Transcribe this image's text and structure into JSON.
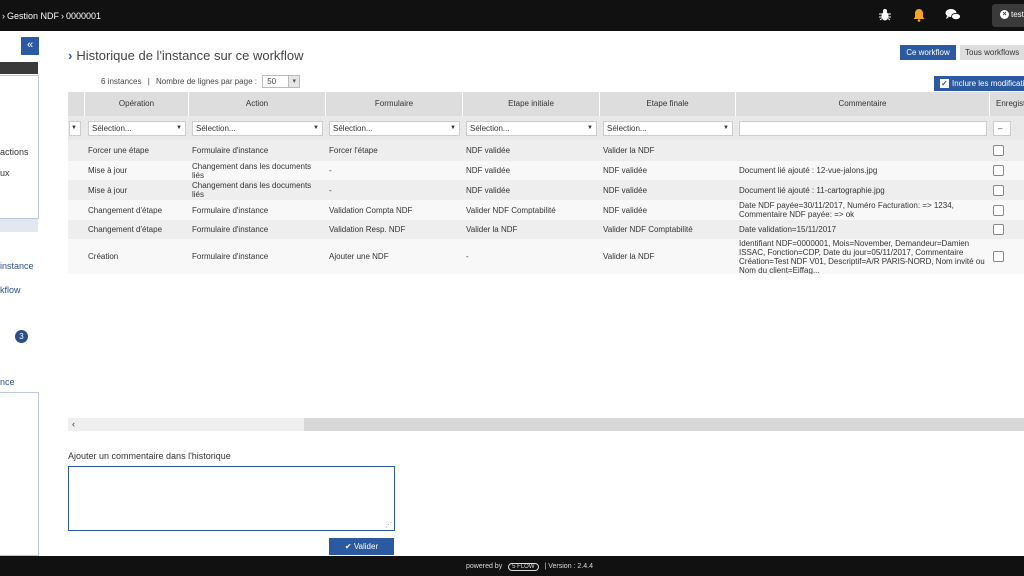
{
  "header": {
    "breadcrumb": [
      "Gestion NDF",
      "0000001"
    ],
    "icons": [
      "bug-icon",
      "bell-icon",
      "chat-icon"
    ],
    "user_label": "test"
  },
  "sidebar": {
    "items": [
      {
        "label": "actions"
      },
      {
        "label": "ux"
      },
      {
        "label": "instance"
      },
      {
        "label": "kflow"
      },
      {
        "label": "nce"
      }
    ],
    "badge": "3"
  },
  "main": {
    "title": "Historique de l'instance sur ce workflow",
    "buttons": {
      "ce_workflow": "Ce workflow",
      "tous_workflows": "Tous workflows"
    },
    "include_changes_label": "Inclure les modifications",
    "instance_count": "6 instances",
    "separator": "|",
    "rows_per_page_label": "Nombre de lignes par page :",
    "rows_per_page_value": "50"
  },
  "table": {
    "columns": [
      "Opération",
      "Action",
      "Formulaire",
      "Etape initiale",
      "Etape finale",
      "Commentaire",
      "Enregistrer"
    ],
    "filter_placeholder": "Sélection...",
    "rows": [
      {
        "operation": "Forcer une étape",
        "action": "Formulaire d'instance",
        "formulaire": "Forcer l'étape",
        "etape_initiale": "NDF validée",
        "etape_finale": "Valider la NDF",
        "commentaire": ""
      },
      {
        "operation": "Mise à jour",
        "action": "Changement dans les documents liés",
        "formulaire": "-",
        "etape_initiale": "NDF validée",
        "etape_finale": "NDF validée",
        "commentaire": "Document lié ajouté : 12-vue-jalons.jpg"
      },
      {
        "operation": "Mise à jour",
        "action": "Changement dans les documents liés",
        "formulaire": "-",
        "etape_initiale": "NDF validée",
        "etape_finale": "NDF validée",
        "commentaire": "Document lié ajouté : 11-cartographie.jpg"
      },
      {
        "operation": "Changement d'étape",
        "action": "Formulaire d'instance",
        "formulaire": "Validation Compta NDF",
        "etape_initiale": "Valider NDF Comptabilité",
        "etape_finale": "NDF validée",
        "commentaire": "Date NDF payée=30/11/2017, Numéro Facturation: => 1234, Commentaire NDF payée: => ok"
      },
      {
        "operation": "Changement d'étape",
        "action": "Formulaire d'instance",
        "formulaire": "Validation Resp. NDF",
        "etape_initiale": "Valider la NDF",
        "etape_finale": "Valider NDF Comptabilité",
        "commentaire": "Date validation=15/11/2017"
      },
      {
        "operation": "Création",
        "action": "Formulaire d'instance",
        "formulaire": "Ajouter une NDF",
        "etape_initiale": "-",
        "etape_finale": "Valider la NDF",
        "commentaire": "Identifiant NDF=0000001, Mois=November, Demandeur=Damien ISSAC, Fonction=CDP, Date du jour=05/11/2017, Commentaire Création=Test NDF V01, Descriptif=A/R PARIS-NORD, Nom invité ou Nom du client=Eiffag..."
      }
    ]
  },
  "comment": {
    "label": "Ajouter un commentaire dans l'historique",
    "value": "",
    "submit_label": "Valider"
  },
  "footer": {
    "powered_by": "powered by",
    "logo_text": "5 FLOW",
    "version": "Version : 2.4.4",
    "separator": "|"
  },
  "colors": {
    "accent": "#2c5aa0",
    "topbar": "#111111",
    "bell": "#f5a623"
  }
}
